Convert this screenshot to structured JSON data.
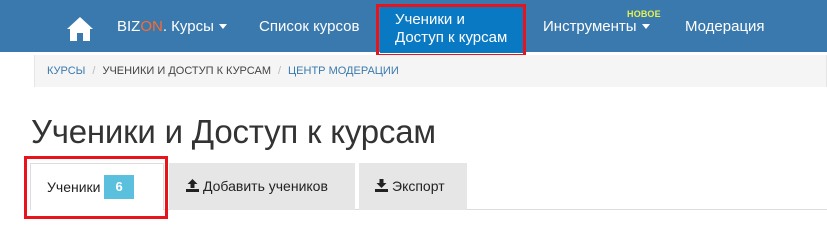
{
  "nav": {
    "brand_prefix": "BIZ",
    "brand_on": "ON",
    "brand_suffix": ". Курсы",
    "courses_list": "Список курсов",
    "students_line1": "Ученики и",
    "students_line2": "Доступ к курсам",
    "tools": "Инструменты",
    "tools_badge": "НОВОЕ",
    "moderation": "Модерация"
  },
  "breadcrumb": {
    "item1": "КУРСЫ",
    "item2": "УЧЕНИКИ И ДОСТУП К КУРСАМ",
    "item3": "ЦЕНТР МОДЕРАЦИИ",
    "separator": "/"
  },
  "page": {
    "title": "Ученики и Доступ к курсам"
  },
  "tabs": {
    "students_label": "Ученики",
    "students_count": "6",
    "add_label": "Добавить учеников",
    "export_label": "Экспорт"
  },
  "colors": {
    "nav_bg": "#3a79ad",
    "active_nav_bg": "#0a79c3",
    "highlight": "#e8141c",
    "badge": "#5bc0de",
    "brand_accent": "#ff6a2a",
    "new_badge": "#e6f251"
  },
  "icons": {
    "home": "home-icon",
    "upload": "upload-icon",
    "download": "download-icon"
  }
}
